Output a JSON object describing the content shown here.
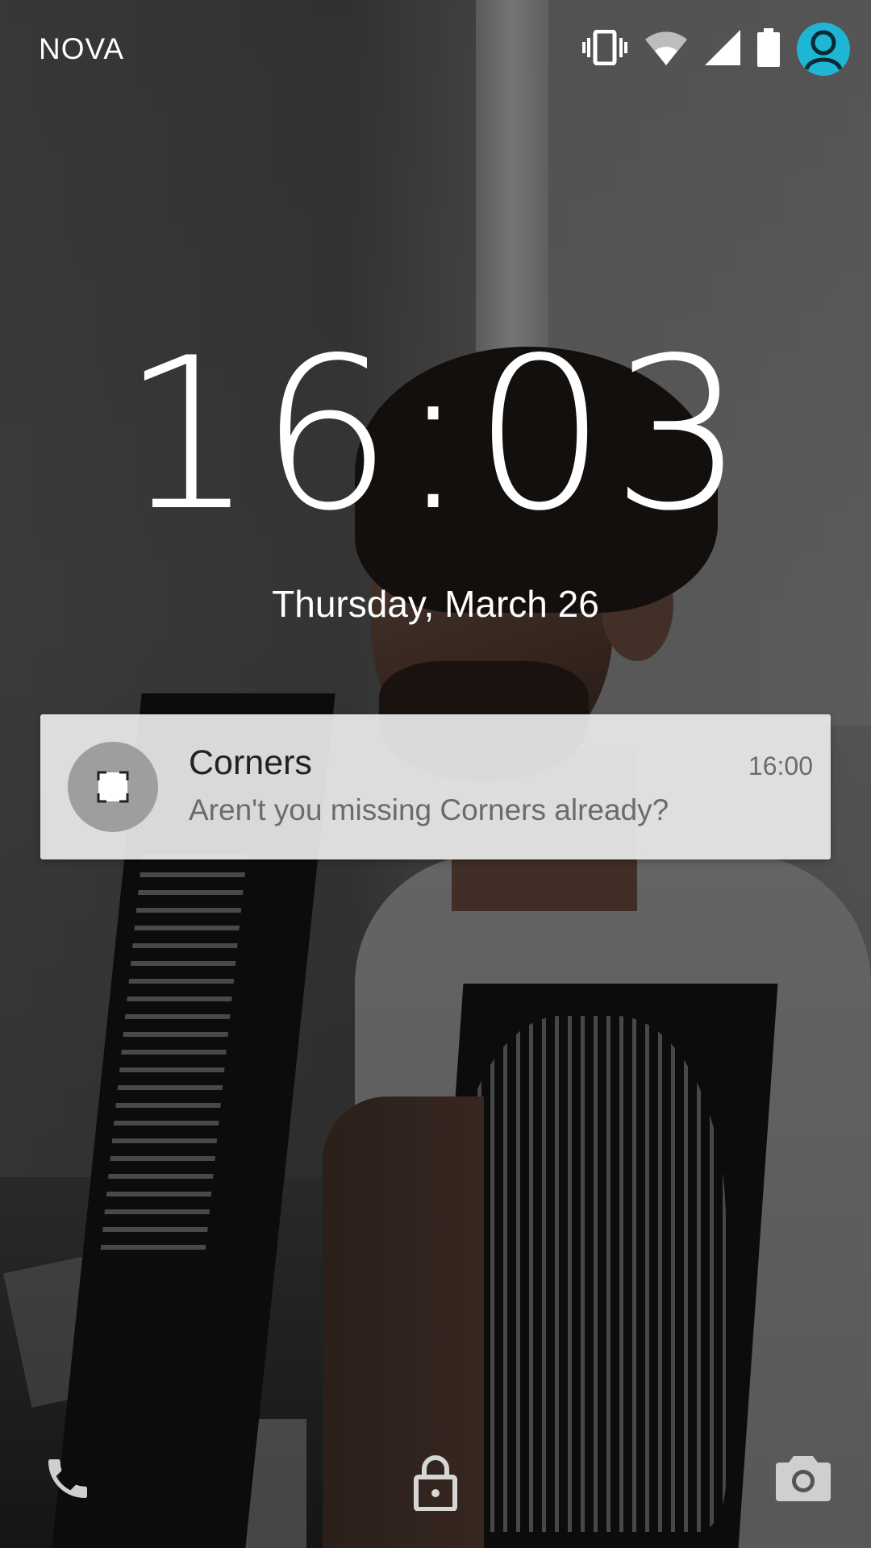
{
  "status_bar": {
    "carrier": "NOVA",
    "icons": [
      "vibrate-icon",
      "wifi-icon",
      "cell-signal-icon",
      "battery-icon",
      "user-avatar-icon"
    ],
    "avatar_color": "#1fb6d6"
  },
  "lockscreen": {
    "time": "16:03",
    "date": "Thursday, March 26"
  },
  "notification": {
    "app_icon": "corners-app-icon",
    "title": "Corners",
    "body": "Aren't you missing Corners already?",
    "time": "16:00"
  },
  "bottom_actions": {
    "left": "phone-icon",
    "center": "lock-icon",
    "right": "camera-icon"
  }
}
